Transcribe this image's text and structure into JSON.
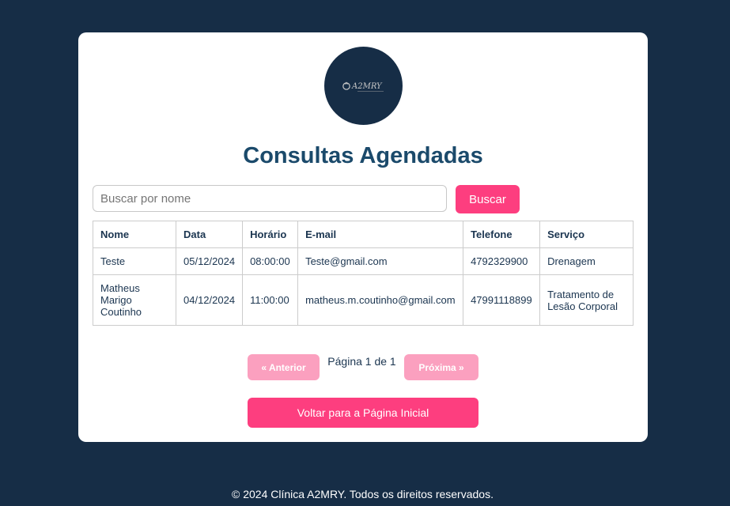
{
  "logo": {
    "text": "A2MRY",
    "icon": "a2mry-logo-icon"
  },
  "page_title": "Consultas Agendadas",
  "search": {
    "placeholder": "Buscar por nome",
    "value": "",
    "button_label": "Buscar"
  },
  "table": {
    "headers": [
      "Nome",
      "Data",
      "Horário",
      "E-mail",
      "Telefone",
      "Serviço"
    ],
    "rows": [
      {
        "nome": "Teste",
        "data": "05/12/2024",
        "horario": "08:00:00",
        "email": "Teste@gmail.com",
        "telefone": "4792329900",
        "servico": "Drenagem"
      },
      {
        "nome": "Matheus Marigo Coutinho",
        "data": "04/12/2024",
        "horario": "11:00:00",
        "email": "matheus.m.coutinho@gmail.com",
        "telefone": "47991118899",
        "servico": "Tratamento de Lesão Corporal"
      }
    ]
  },
  "pagination": {
    "prev_label": "« Anterior",
    "info": "Página 1 de 1",
    "next_label": "Próxima »"
  },
  "home_button_label": "Voltar para a Página Inicial",
  "footer": "© 2024 Clínica A2MRY. Todos os direitos reservados.",
  "colors": {
    "background": "#162d46",
    "accent": "#fd3e7f",
    "accent_disabled": "#fba0bf",
    "title": "#1b4a6b"
  }
}
